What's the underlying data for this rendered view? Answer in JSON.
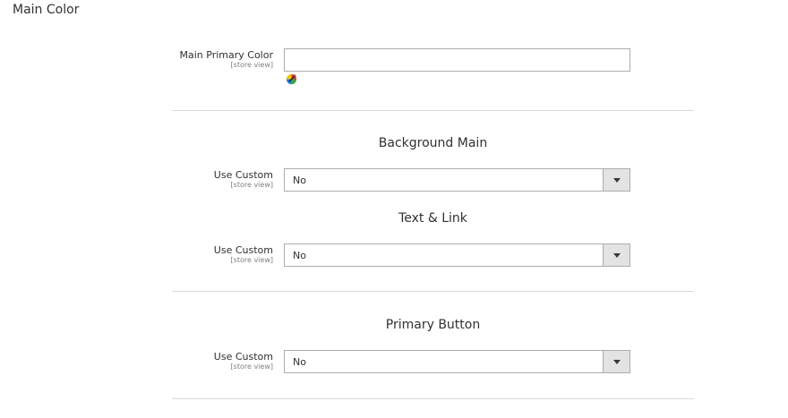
{
  "section": {
    "title": "Main Color"
  },
  "main_primary_color": {
    "label": "Main Primary Color",
    "scope": "[store view]",
    "value": "",
    "picker_icon": "color-wheel-icon"
  },
  "groups": [
    {
      "heading": "Background Main",
      "field_label": "Use Custom",
      "scope": "[store view]",
      "selected": "No"
    },
    {
      "heading": "Text & Link",
      "field_label": "Use Custom",
      "scope": "[store view]",
      "selected": "No"
    },
    {
      "heading": "Primary Button",
      "field_label": "Use Custom",
      "scope": "[store view]",
      "selected": "No"
    }
  ],
  "colors": {
    "text": "#303030",
    "scope_text": "#808080",
    "input_border": "#adadad",
    "toggle_bg": "#e3e3e3",
    "divider": "#d9d9d9"
  }
}
